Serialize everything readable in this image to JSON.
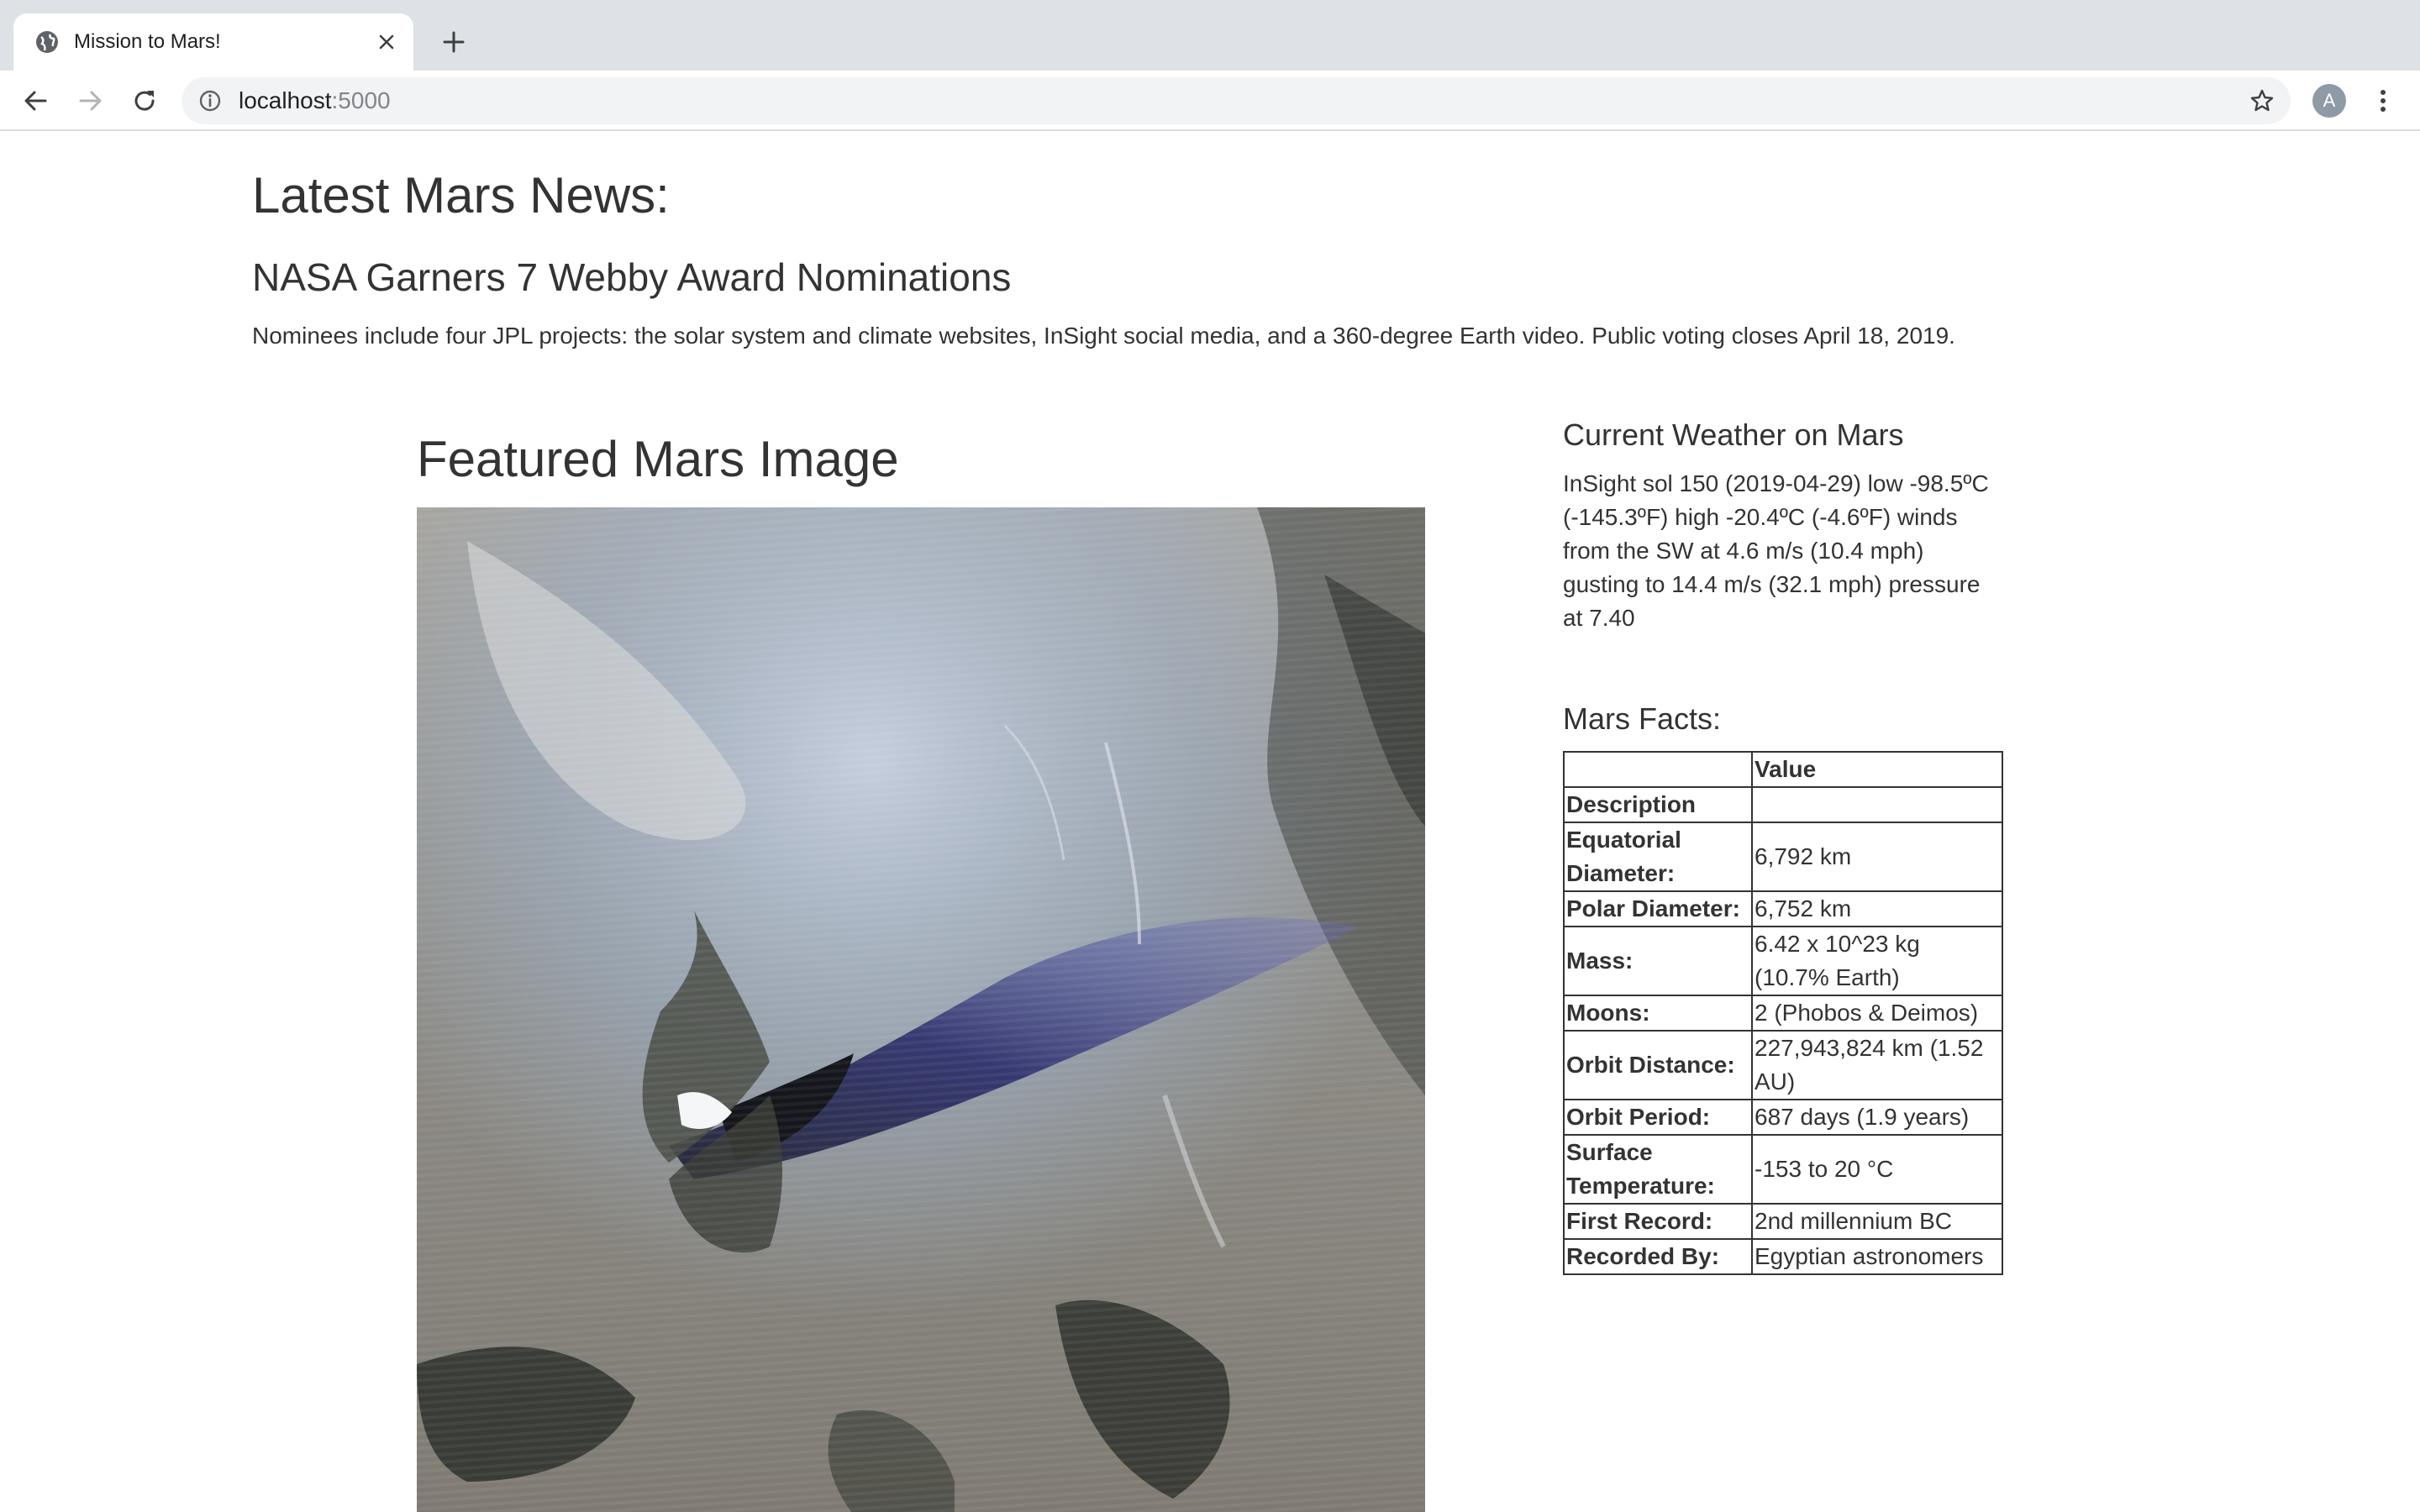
{
  "browser": {
    "tab_title": "Mission to Mars!",
    "url_host": "localhost",
    "url_port": ":5000",
    "avatar_letter": "A"
  },
  "icons": {
    "favicon": "globe-icon",
    "tab_close": "close-icon",
    "new_tab": "plus-icon",
    "back": "arrow-left-icon",
    "forward": "arrow-right-icon",
    "reload": "reload-icon",
    "site_info": "info-icon",
    "bookmark": "star-icon",
    "menu": "kebab-menu-icon"
  },
  "news": {
    "heading": "Latest Mars News:",
    "title": "NASA Garners 7 Webby Award Nominations",
    "paragraph": "Nominees include four JPL projects: the solar system and climate websites, InSight social media, and a 360-degree Earth video. Public voting closes April 18, 2019."
  },
  "featured": {
    "heading": "Featured Mars Image"
  },
  "weather": {
    "heading": "Current Weather on Mars",
    "text": "InSight sol 150 (2019-04-29) low -98.5ºC (-145.3ºF) high -20.4ºC (-4.6ºF) winds from the SW at 4.6 m/s (10.4 mph) gusting to 14.4 m/s (32.1 mph) pressure at 7.40"
  },
  "facts": {
    "heading": "Mars Facts:",
    "column_header": "Value",
    "index_header": "Description",
    "rows": [
      {
        "label": "Equatorial Diameter:",
        "value": "6,792 km"
      },
      {
        "label": "Polar Diameter:",
        "value": "6,752 km"
      },
      {
        "label": "Mass:",
        "value": "6.42 x 10^23 kg (10.7% Earth)"
      },
      {
        "label": "Moons:",
        "value": "2 (Phobos & Deimos)"
      },
      {
        "label": "Orbit Distance:",
        "value": "227,943,824 km (1.52 AU)"
      },
      {
        "label": "Orbit Period:",
        "value": "687 days (1.9 years)"
      },
      {
        "label": "Surface Temperature:",
        "value": "-153 to 20 °C"
      },
      {
        "label": "First Record:",
        "value": "2nd millennium BC"
      },
      {
        "label": "Recorded By:",
        "value": "Egyptian astronomers"
      }
    ]
  }
}
